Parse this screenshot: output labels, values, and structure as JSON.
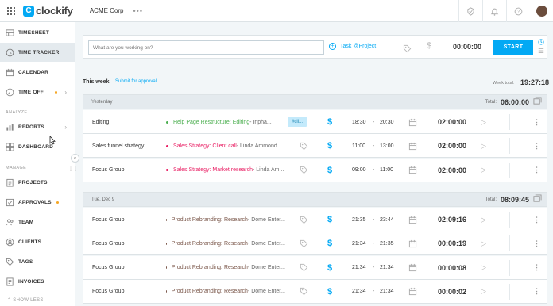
{
  "topbar": {
    "logo_text": "clockify",
    "logo_mark": "C",
    "workspace": "ACME Corp",
    "workspace_menu": "•••",
    "icons": [
      "help-shield-icon",
      "bell-icon",
      "question-icon"
    ]
  },
  "sidebar": {
    "items": [
      {
        "label": "TIMESHEET",
        "icon": "timesheet-icon"
      },
      {
        "label": "TIME TRACKER",
        "icon": "clock-icon",
        "active": true
      },
      {
        "label": "CALENDAR",
        "icon": "calendar-icon"
      },
      {
        "label": "TIME OFF",
        "icon": "time-off-icon",
        "arrow": "›"
      }
    ],
    "section_analyze": "ANALYZE",
    "analyze_items": [
      {
        "label": "REPORTS",
        "icon": "reports-icon",
        "arrow": "›"
      },
      {
        "label": "DASHBOARD",
        "icon": "dashboard-icon"
      }
    ],
    "section_manage": "MANAGE",
    "manage_items": [
      {
        "label": "PROJECTS",
        "icon": "projects-icon"
      },
      {
        "label": "APPROVALS",
        "icon": "approvals-icon"
      },
      {
        "label": "TEAM",
        "icon": "team-icon"
      },
      {
        "label": "CLIENTS",
        "icon": "clients-icon"
      },
      {
        "label": "TAGS",
        "icon": "tag-icon"
      },
      {
        "label": "INVOICES",
        "icon": "invoices-icon"
      }
    ],
    "show_less": "SHOW LESS",
    "collapse": "«"
  },
  "timer": {
    "placeholder": "What are you working on?",
    "task_project": "Task @Project",
    "time": "00:00:00",
    "start_label": "START"
  },
  "week": {
    "title": "This week",
    "submit": "Submit for approval",
    "total_label": "Week total:",
    "total_value": "19:27:18"
  },
  "days": [
    {
      "label": "Yesterday",
      "total_label": "Total:",
      "total": "06:00:00",
      "entries": [
        {
          "desc": "Editing",
          "project": "Help Page Restructure: Editing",
          "client": " - Inpha...",
          "color": "#4caf50",
          "tag": "#cli...",
          "start": "18:30",
          "end": "20:30",
          "duration": "02:00:00"
        },
        {
          "desc": "Sales funnel strategy",
          "project": "Sales Strategy: Client call",
          "client": " - Linda Ammond",
          "color": "#e91e63",
          "start": "11:00",
          "end": "13:00",
          "duration": "02:00:00"
        },
        {
          "desc": "Focus Group",
          "project": "Sales Strategy: Market research",
          "client": " - Linda Am...",
          "color": "#e91e63",
          "start": "09:00",
          "end": "11:00",
          "duration": "02:00:00"
        }
      ]
    },
    {
      "label": "Tue, Dec 9",
      "total_label": "Total:",
      "total": "08:09:45",
      "entries": [
        {
          "desc": "Focus Group",
          "project": "Product Rebranding: Research",
          "client": " - Dome Enter...",
          "color": "#795548",
          "start": "21:35",
          "end": "23:44",
          "duration": "02:09:16"
        },
        {
          "desc": "Focus Group",
          "project": "Product Rebranding: Research",
          "client": " - Dome Enter...",
          "color": "#795548",
          "start": "21:34",
          "end": "21:35",
          "duration": "00:00:19"
        },
        {
          "desc": "Focus Group",
          "project": "Product Rebranding: Research",
          "client": " - Dome Enter...",
          "color": "#795548",
          "start": "21:34",
          "end": "21:34",
          "duration": "00:00:08"
        },
        {
          "desc": "Focus Group",
          "project": "Product Rebranding: Research",
          "client": " - Dome Enter...",
          "color": "#795548",
          "start": "21:34",
          "end": "21:34",
          "duration": "00:00:02"
        }
      ]
    }
  ],
  "colors": {
    "accent": "#03a9f4",
    "sidebar_active": "#e4eaee",
    "approvals_dot": "#f5a623"
  }
}
